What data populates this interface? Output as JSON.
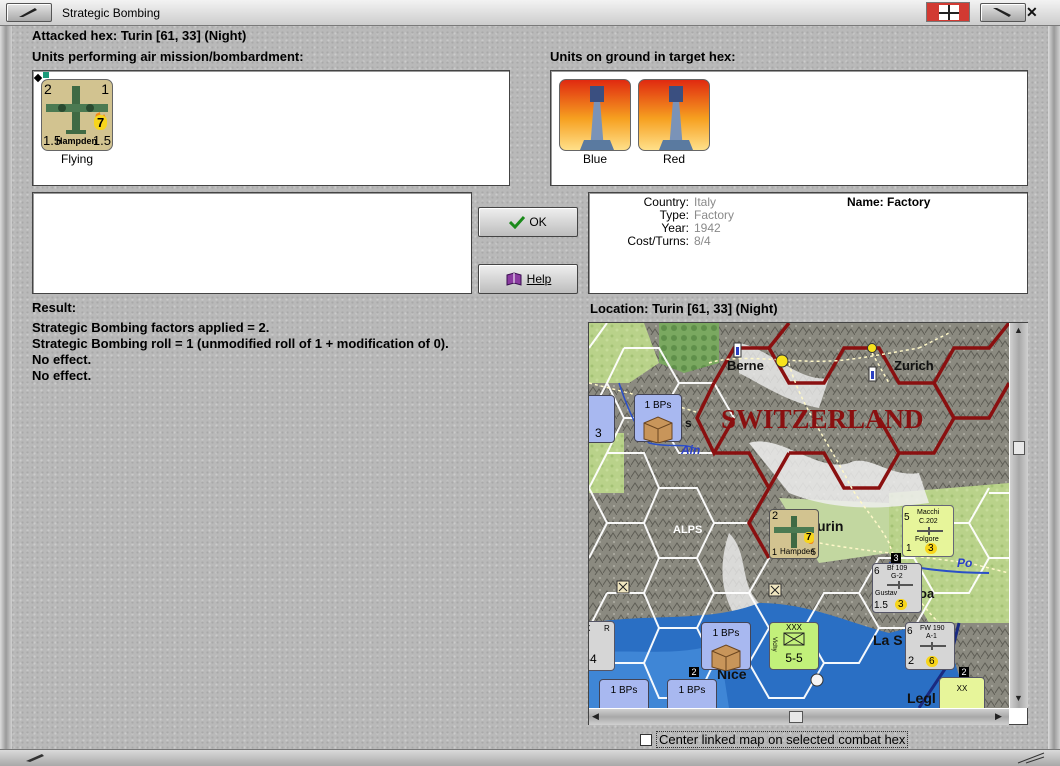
{
  "window": {
    "title": "Strategic Bombing"
  },
  "attacked": {
    "label": "Attacked hex: Turin  [61, 33] (Night)"
  },
  "air_units": {
    "label": "Units performing air mission/bombardment:",
    "unit": {
      "name": "Hampden",
      "left_factor": "2",
      "right_factor": "1",
      "bottom_left": "1.5",
      "bottom_right": "1.5",
      "badge": "7",
      "status": "Flying"
    }
  },
  "ground_units": {
    "label": "Units on ground in target hex:",
    "units": [
      {
        "caption": "Blue"
      },
      {
        "caption": "Red"
      }
    ]
  },
  "buttons": {
    "ok": "OK",
    "help": "Help"
  },
  "target": {
    "country_k": "Country:",
    "country_v": "Italy",
    "type_k": "Type:",
    "type_v": "Factory",
    "year_k": "Year:",
    "year_v": "1942",
    "cost_k": "Cost/Turns:",
    "cost_v": "8/4",
    "name": "Name: Factory"
  },
  "result": {
    "label": "Result:",
    "lines": [
      "Strategic Bombing factors applied = 2.",
      "Strategic Bombing roll = 1 (unmodified roll of 1 + modification of 0).",
      "No effect.",
      "No effect."
    ]
  },
  "location": {
    "label": "Location:  Turin  [61, 33] (Night)"
  },
  "map": {
    "country_label": "SWITZERLAND",
    "cities": {
      "berne": "Berne",
      "zurich": "Zurich",
      "turin": "urin",
      "nice": "Nice",
      "las": "La S",
      "legh": "Legl",
      "genoa": "oa",
      "s": "s"
    },
    "regions": {
      "alps": "ALPS",
      "ain": "Ain",
      "po": "Po"
    },
    "units": {
      "bp1": "1 BPs",
      "bp2": "1 BPs",
      "bp3": "1 BPs",
      "bp4": "1 BPs",
      "bp5": "1 BPs",
      "macchi_name": "Macchi",
      "macchi_model": "C.202",
      "macchi_sub": "Folgore",
      "macchi_l": "5",
      "macchi_v": "1",
      "macchi_b": "3",
      "bf_name": "Bf 109",
      "bf_model": "G-2",
      "bf_sub": "Gustav",
      "bf_l": "6",
      "bf_v": "1.5",
      "bf_b": "3",
      "fw_name": "FW 190",
      "fw_model": "A-1",
      "fw_l": "6",
      "fw_v": "2",
      "fw_b": "6",
      "hamp_l": "2",
      "hamp_v": "1",
      "hamp_b": "7",
      "hamp_name": "Hampden",
      "hamp_f": "5",
      "corps_type": "XXX",
      "corps_val": "5-5",
      "corps_side": "Vichy",
      "small_3": "3",
      "small_x": "X",
      "small_r": "R",
      "small_4": "-4",
      "small_xx": "XX",
      "stack_2": "2",
      "stack_2b": "2",
      "stack_3": "3"
    }
  },
  "footer": {
    "center_checkbox": "Center linked map on selected combat hex"
  }
}
